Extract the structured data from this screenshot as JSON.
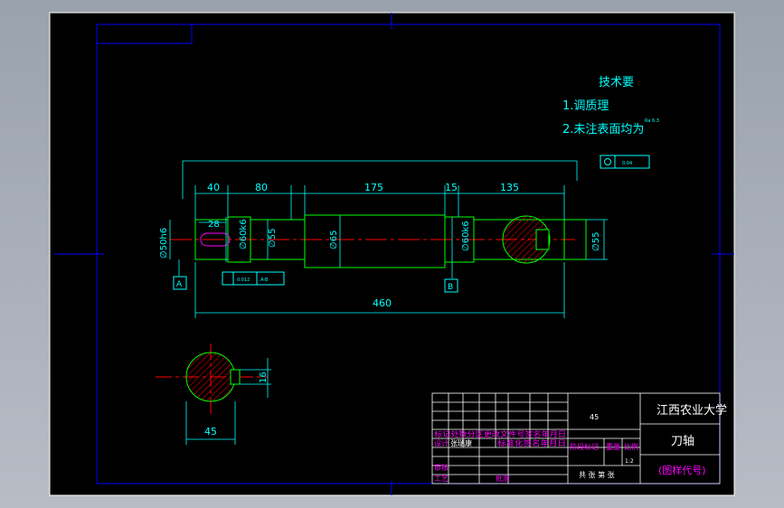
{
  "colors": {
    "background": "#000000",
    "frame": "#ffffff",
    "border": "#0000ff",
    "dimension": "#00ffff",
    "outline": "#00ff00",
    "center": "#ff0000",
    "hatch": "#ff0000",
    "note": "#00ffff",
    "titleblock_magenta": "#ff00ff",
    "titleblock_text": "#ffffff"
  },
  "notes": {
    "title": "技术要",
    "line1": "1.调质理",
    "line2": "2.未注表面均为",
    "roughness": "Ra 6.3"
  },
  "dims": {
    "d40": "40",
    "d80": "80",
    "d175": "175",
    "d15": "15",
    "d135": "135",
    "d28": "28",
    "d460": "460",
    "dia50": "∅50h6",
    "dia60a": "∅60k6",
    "dia55a": "∅55",
    "dia65": "∅65",
    "dia60b": "∅60k6",
    "dia55b": "∅55",
    "sec45": "45",
    "sec16": "16",
    "datumA": "A",
    "datumB": "B",
    "tol1": "0.012",
    "tol1b": "A-B",
    "tol2": "0.04"
  },
  "titleblock": {
    "school": "江西农业大学",
    "part": "刀轴",
    "code": "(图样代号)",
    "material": "45",
    "scale": "1:2",
    "row_std": "标记处数分区更改文件号签名年月日",
    "row_design": "设计",
    "row_designer": "张瑞康",
    "row_std2": "标准化签名年月日",
    "row_stage": "阶段标记",
    "row_weight": "重量",
    "row_ratio": "比例",
    "row_check": "审核",
    "row_craft": "工艺",
    "row_approve": "批准",
    "row_sheets": "共 张 第 张"
  }
}
